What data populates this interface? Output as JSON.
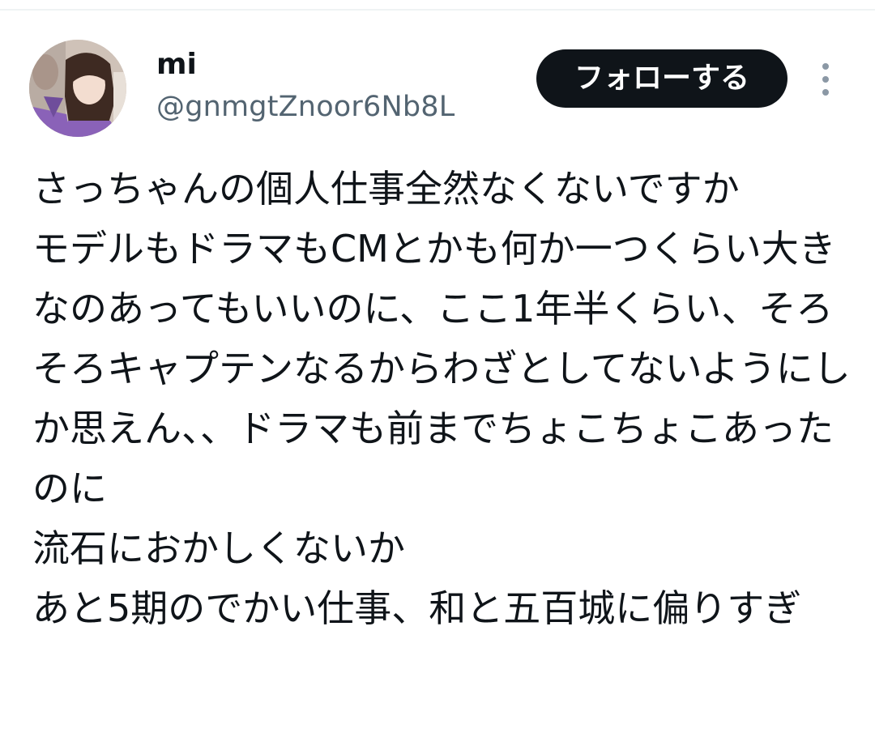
{
  "tweet": {
    "author": {
      "display_name": "mi",
      "handle": "@gnmgtZnoor6Nb8L"
    },
    "follow_button_label": "フォローする",
    "more_icon": "more-vertical-icon",
    "text": "さっちゃんの個人仕事全然なくないですか\nモデルもドラマもCMとかも何か一つくらい大きなのあってもいいのに、ここ1年半くらい、そろそろキャプテンなるからわざとしてないようにしか思えん、、ドラマも前までちょこちょこあったのに\n流石におかしくないか\nあと5期のでかい仕事、和と五百城に偏りすぎ"
  },
  "colors": {
    "text_primary": "#0f1419",
    "text_secondary": "#536471",
    "button_bg": "#0f1419",
    "button_text": "#ffffff",
    "divider": "#eff3f4"
  }
}
